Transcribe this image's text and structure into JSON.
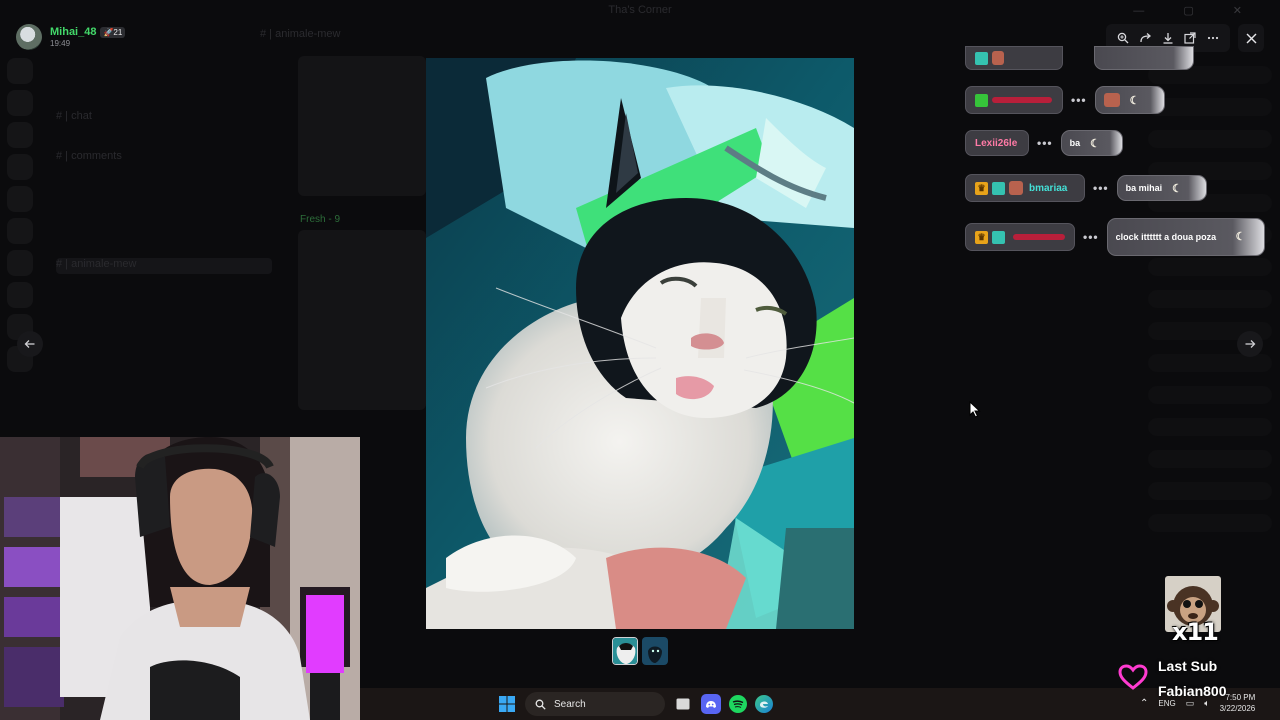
{
  "viewer": {
    "user": {
      "name": "Mihai_48",
      "badge": "🚀21",
      "time": "19:49"
    },
    "toolbar": {
      "icons": [
        "zoom-icon",
        "forward-icon",
        "download-icon",
        "open-external-icon",
        "more-icon"
      ],
      "close_icon": "close-icon"
    }
  },
  "background": {
    "header_channel": "# | animale-mew",
    "window_title": "Tha's Corner",
    "channels": [
      "# | chat",
      "# | comments",
      "# | animale-mew"
    ],
    "tag": "Fresh - 9"
  },
  "chat": [
    {
      "user": "Lexii26le",
      "user_color": "#ff6fa0",
      "message": "ba"
    },
    {
      "user": "bmariaa",
      "user_color": "#35d9d0",
      "message": "ba mihai"
    },
    {
      "user": "",
      "user_color": "#e0334a",
      "message": "clock itttttt a doua poza"
    }
  ],
  "taskbar": {
    "search_placeholder": "Search",
    "lang": "ENG",
    "time": "7:50 PM",
    "date": "3/22/2026"
  },
  "sub_alert": {
    "count": "x11",
    "title": "Last Sub",
    "name": "Fabian800"
  },
  "colors": {
    "accent_green": "#43d96a",
    "heart": "#ff3bd0"
  }
}
